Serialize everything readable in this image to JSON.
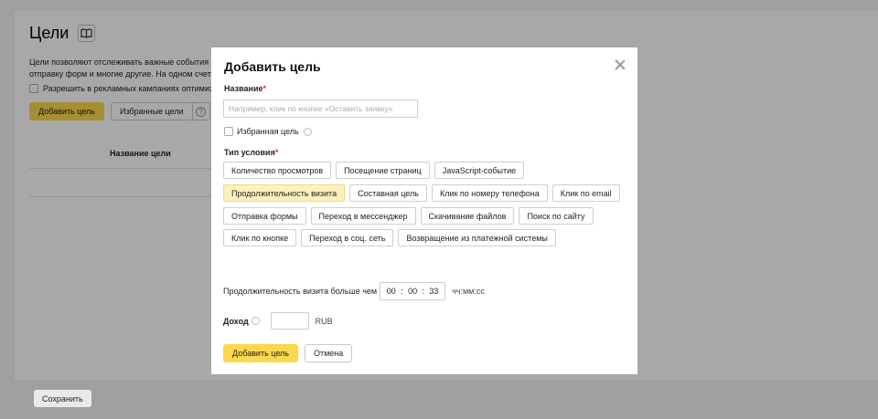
{
  "background": {
    "title": "Цели",
    "desc_line1": "Цели позволяют отслеживать важные события н",
    "desc_line2": "отправку форм и многие другие. На одном счетч",
    "checkbox_label": "Разрешить в рекламных кампаниях оптимиз",
    "add_goal_button": "Добавить цель",
    "favorite_goals_button": "Избранные цели",
    "help_symbol": "?",
    "table_header": "Название цели",
    "save_button": "Сохранить"
  },
  "modal": {
    "title": "Добавить цель",
    "name_label": "Название",
    "required_mark": "*",
    "name_placeholder": "Например, клик по кнопке «Оставить заявку»",
    "favorite_label": "Избранная цель",
    "condition_type_label": "Тип условия",
    "condition_types": [
      [
        "Количество просмотров",
        "Посещение страниц",
        "JavaScript-событие"
      ],
      [
        "Продолжительность визита",
        "Составная цель",
        "Клик по номеру телефона",
        "Клик по email"
      ],
      [
        "Отправка формы",
        "Переход в мессенджер",
        "Скачивание файлов",
        "Поиск по сайту"
      ],
      [
        "Клик по кнопке",
        "Переход в соц. сеть",
        "Возвращение из платежной системы"
      ]
    ],
    "selected_condition": "Продолжительность визита",
    "duration_label": "Продолжительность визита больше чем",
    "duration": {
      "hh": "00",
      "mm": "00",
      "ss": "33",
      "sep": ":"
    },
    "duration_unit": "чч:мм:сс",
    "income_label": "Доход",
    "income_value": "",
    "currency": "RUB",
    "add_button": "Добавить цель",
    "cancel_button": "Отмена"
  }
}
